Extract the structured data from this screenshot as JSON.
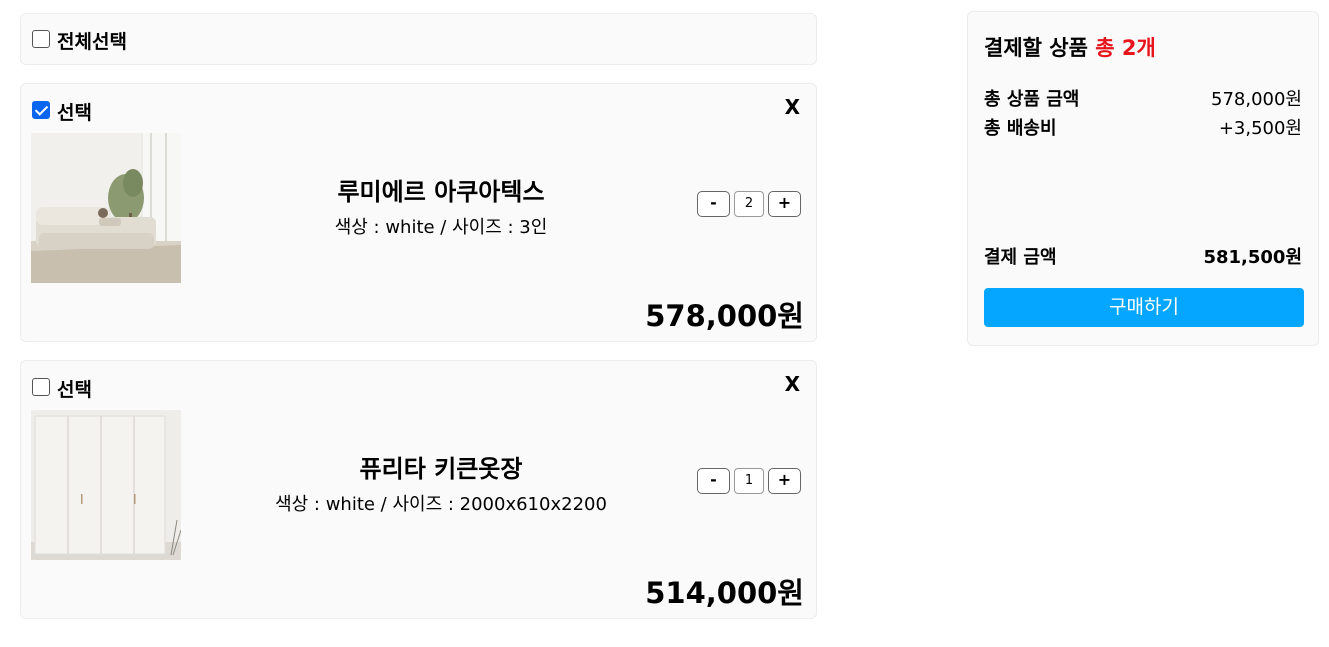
{
  "select_all": {
    "label": "전체선택",
    "checked": false
  },
  "cart_items": [
    {
      "select_label": "선택",
      "checked": true,
      "remove_label": "X",
      "name": "루미에르 아쿠아텍스",
      "options": "색상 : white / 사이즈 : 3인",
      "minus_label": "-",
      "quantity": "2",
      "plus_label": "+",
      "price": "578,000원"
    },
    {
      "select_label": "선택",
      "checked": false,
      "remove_label": "X",
      "name": "퓨리타 키큰옷장",
      "options": "색상 : white / 사이즈 : 2000x610x2200",
      "minus_label": "-",
      "quantity": "1",
      "plus_label": "+",
      "price": "514,000원"
    }
  ],
  "summary": {
    "title": "결제할 상품",
    "count_text": "총 2개",
    "total_products_label": "총 상품 금액",
    "total_products_value": "578,000원",
    "shipping_label": "총 배송비",
    "shipping_value": "+3,500원",
    "payment_label": "결제 금액",
    "payment_value": "581,500원",
    "buy_label": "구매하기"
  },
  "colors": {
    "accent": "#05a6ff",
    "count_red": "#e8141b",
    "checkbox_checked": "#0a66f0"
  }
}
